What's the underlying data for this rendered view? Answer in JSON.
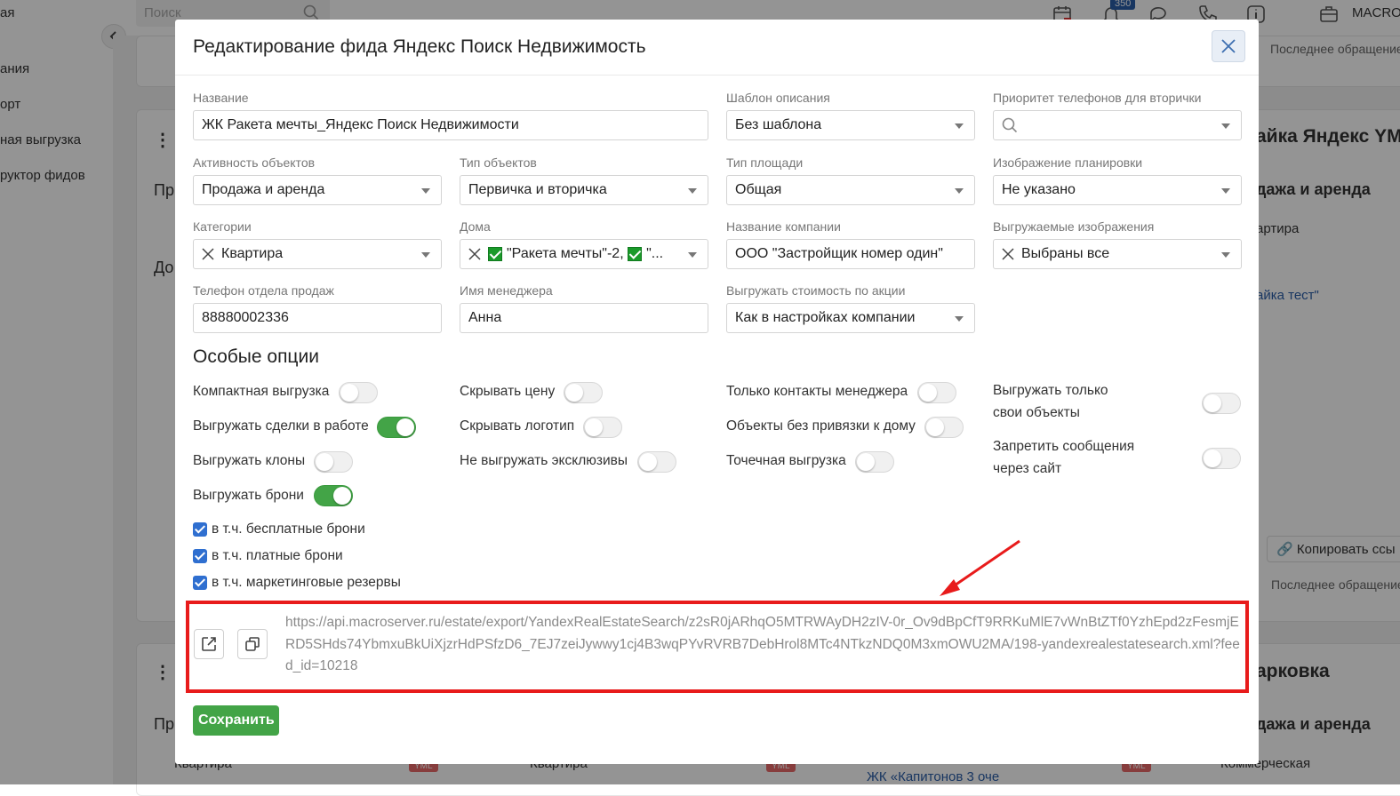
{
  "background": {
    "sidebar_items": [
      "ая",
      "ания",
      "орт",
      "ная выгрузка",
      "руктор фидов"
    ],
    "search_placeholder": "Поиск",
    "notification_count": "350",
    "account_name": "MACRO",
    "last_access": "Последнее обращение",
    "card_right_title": "айка Яндекс YM",
    "card_right_activity": "дажа и аренда",
    "card_right_category": "артира",
    "card_right_link": "айка тест\"",
    "card_right_title_2": "арковка",
    "card_right_activity_2": "дажа и аренда",
    "card_right_category_2": "Коммерческая",
    "left_pr": "Пр",
    "left_do": "До",
    "left_pr_2": "Пр",
    "bottom_category_1": "Квартира",
    "bottom_category_2": "Квартира",
    "bottom_link": "ЖК «Капитонов 3 оче",
    "copy_link": "Копировать ссы",
    "yml": "YML"
  },
  "modal": {
    "title": "Редактирование фида Яндекс Поиск Недвижимость",
    "fields": {
      "name": {
        "label": "Название",
        "value": "ЖК Ракета мечты_Яндекс Поиск Недвижимости"
      },
      "description_template": {
        "label": "Шаблон описания",
        "value": "Без шаблона"
      },
      "phone_priority": {
        "label": "Приоритет телефонов для вторички",
        "value": ""
      },
      "activity": {
        "label": "Активность объектов",
        "value": "Продажа и аренда"
      },
      "object_type": {
        "label": "Тип объектов",
        "value": "Первичка и вторичка"
      },
      "area_type": {
        "label": "Тип площади",
        "value": "Общая"
      },
      "plan_image": {
        "label": "Изображение планировки",
        "value": "Не указано"
      },
      "categories": {
        "label": "Категории",
        "value": "Квартира"
      },
      "houses": {
        "label": "Дома",
        "value_1": "\"Ракета мечты\"-2,",
        "value_2": "\"..."
      },
      "company_name": {
        "label": "Название компании",
        "value": "ООО \"Застройщик номер один\""
      },
      "exported_images": {
        "label": "Выгружаемые изображения",
        "value": "Выбраны все"
      },
      "sales_phone": {
        "label": "Телефон отдела продаж",
        "value": "88880002336"
      },
      "manager_name": {
        "label": "Имя менеджера",
        "value": "Анна"
      },
      "promo_price": {
        "label": "Выгружать стоимость по акции",
        "value": "Как в настройках компании"
      }
    },
    "special_options_title": "Особые опции",
    "options": {
      "compact": {
        "label": "Компактная выгрузка",
        "on": false
      },
      "deals_in_work": {
        "label": "Выгружать сделки в работе",
        "on": true
      },
      "clones": {
        "label": "Выгружать клоны",
        "on": false
      },
      "bookings": {
        "label": "Выгружать брони",
        "on": true
      },
      "hide_price": {
        "label": "Скрывать цену",
        "on": false
      },
      "hide_logo": {
        "label": "Скрывать логотип",
        "on": false
      },
      "no_exclusives": {
        "label": "Не выгружать эксклюзивы",
        "on": false
      },
      "manager_contacts_only": {
        "label": "Только контакты менеджера",
        "on": false
      },
      "no_house_objects": {
        "label": "Объекты без привязки к дому",
        "on": false
      },
      "point_export": {
        "label": "Точечная выгрузка",
        "on": false
      },
      "own_objects_only": {
        "label_1": "Выгружать только",
        "label_2": "свои объекты",
        "on": false
      },
      "forbid_messages": {
        "label_1": "Запретить сообщения",
        "label_2": "через сайт",
        "on": false
      }
    },
    "booking_checkboxes": [
      {
        "label": "в т.ч. бесплатные брони",
        "checked": true
      },
      {
        "label": "в т.ч. платные брони",
        "checked": true
      },
      {
        "label": "в т.ч. маркетинговые резервы",
        "checked": true
      }
    ],
    "feed_url": "https://api.macroserver.ru/estate/export/YandexRealEstateSearch/z2sR0jARhqO5MTRWAyDH2zIV-0r_Ov9dBpCfT9RRKuMlE7vWnBtZTf0YzhEpd2zFesmjERD5SHds74YbmxuBkUiXjzrHdPSfzD6_7EJ7zeiJywwy1cj4B3wqPYvRVRB7DebHrol8MTc4NTkzNDQ0M3xmOWU2MA/198-yandexrealestatesearch.xml?feed_id=10218",
    "save_label": "Сохранить"
  },
  "colors": {
    "accent_green": "#43a447",
    "highlight_red": "#e81b1b",
    "link_blue": "#2a5da8"
  }
}
